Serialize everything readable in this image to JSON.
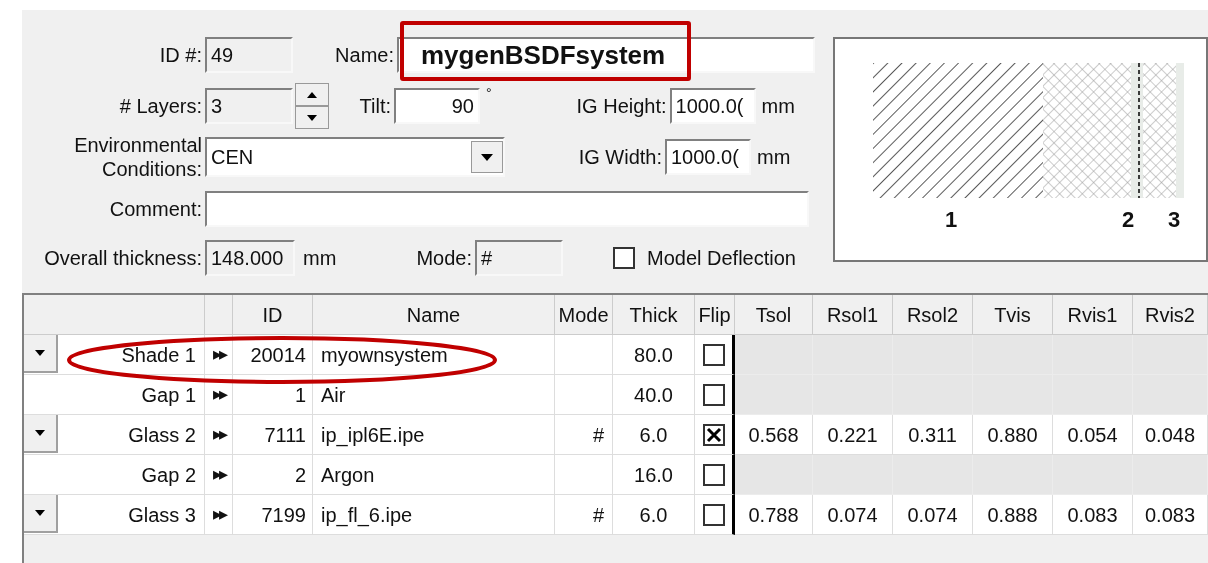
{
  "form": {
    "id_label": "ID #:",
    "id_value": "49",
    "name_label": "Name:",
    "name_value": "mygenBSDFsystem",
    "layers_label": "# Layers:",
    "layers_value": "3",
    "tilt_label": "Tilt:",
    "tilt_value": "90",
    "tilt_unit": "°",
    "ig_height_label": "IG Height:",
    "ig_height_value": "1000.0(",
    "ig_height_unit": "mm",
    "env_label_line1": "Environmental",
    "env_label_line2": "Conditions:",
    "env_value": "CEN",
    "ig_width_label": "IG Width:",
    "ig_width_value": "1000.0(",
    "ig_width_unit": "mm",
    "comment_label": "Comment:",
    "thickness_label": "Overall thickness:",
    "thickness_value": "148.000",
    "thickness_unit": "mm",
    "mode_label": "Mode:",
    "mode_value": "#",
    "deflection_label": "Model Deflection",
    "deflection_checked": false
  },
  "diagram": {
    "labels": [
      "1",
      "2",
      "3"
    ]
  },
  "table": {
    "columns": [
      "ID",
      "Name",
      "Mode",
      "Thick",
      "Flip",
      "Tsol",
      "Rsol1",
      "Rsol2",
      "Tvis",
      "Rvis1",
      "Rvis2"
    ],
    "rows": [
      {
        "kind": "shade",
        "layer": "Shade 1",
        "arrows": "▸▸",
        "id": "20014",
        "name": "myownsystem",
        "mode": "",
        "thick": "80.0",
        "flip": false,
        "optics": []
      },
      {
        "kind": "gap",
        "layer": "Gap 1",
        "arrows": "▸▸",
        "id": "1",
        "name": "Air",
        "mode": "",
        "thick": "40.0",
        "flip": false,
        "optics": []
      },
      {
        "kind": "glass",
        "layer": "Glass 2",
        "arrows": "▸▸",
        "id": "7111",
        "name": "ip_ipl6E.ipe",
        "mode": "#",
        "thick": "6.0",
        "flip": true,
        "optics": [
          "0.568",
          "0.221",
          "0.311",
          "0.880",
          "0.054",
          "0.048"
        ]
      },
      {
        "kind": "gap",
        "layer": "Gap 2",
        "arrows": "▸▸",
        "id": "2",
        "name": "Argon",
        "mode": "",
        "thick": "16.0",
        "flip": false,
        "optics": []
      },
      {
        "kind": "glass",
        "layer": "Glass 3",
        "arrows": "▸▸",
        "id": "7199",
        "name": "ip_fl_6.ipe",
        "mode": "#",
        "thick": "6.0",
        "flip": false,
        "optics": [
          "0.788",
          "0.074",
          "0.074",
          "0.888",
          "0.083",
          "0.083"
        ]
      }
    ]
  }
}
